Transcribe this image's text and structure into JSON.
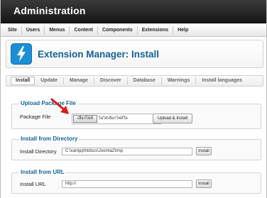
{
  "header": {
    "title": "Administration"
  },
  "menu": {
    "items": [
      {
        "label": "Site"
      },
      {
        "label": "Users"
      },
      {
        "label": "Menus"
      },
      {
        "label": "Content"
      },
      {
        "label": "Components"
      },
      {
        "label": "Extensions"
      },
      {
        "label": "Help"
      }
    ]
  },
  "page": {
    "title": "Extension Manager: Install",
    "icon": "lightning-bolt-icon"
  },
  "tabs": [
    {
      "label": "Install",
      "active": true
    },
    {
      "label": "Update"
    },
    {
      "label": "Manage"
    },
    {
      "label": "Discover"
    },
    {
      "label": "Database"
    },
    {
      "label": "Warnings"
    },
    {
      "label": "Install languages"
    }
  ],
  "upload_package": {
    "legend": "Upload Package File",
    "label": "Package File",
    "browse_label": "เลือกไฟล์",
    "file_status": "ไม่ได้เลือกไฟล์ใด",
    "button_label": "Upload & Install"
  },
  "install_directory": {
    "legend": "Install from Directory",
    "label": "Install Directory",
    "value": "C:\\xampp\\htdocs\\Joomla2\\tmp",
    "button_label": "Install"
  },
  "install_url": {
    "legend": "Install from URL",
    "label": "Install URL",
    "value": "http://",
    "button_label": "Install"
  },
  "colors": {
    "header_bg": "#1e1e1e",
    "accent_blue": "#146295",
    "icon_blue": "#1b8fd6",
    "arrow_red": "#e01818"
  }
}
